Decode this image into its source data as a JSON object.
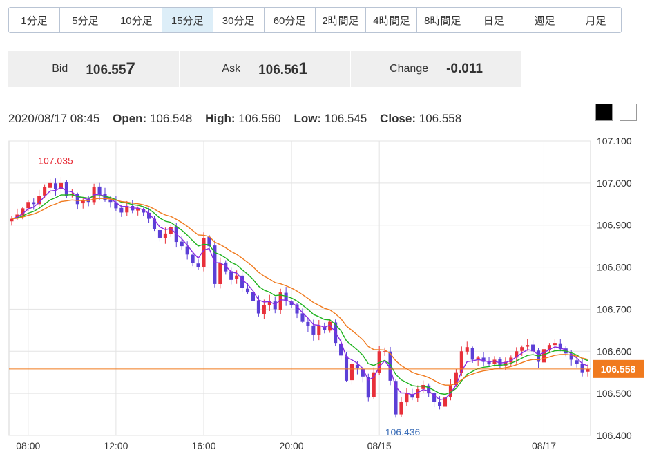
{
  "tabs": [
    "1分足",
    "5分足",
    "10分足",
    "15分足",
    "30分足",
    "60分足",
    "2時間足",
    "4時間足",
    "8時間足",
    "日足",
    "週足",
    "月足"
  ],
  "active_tab": 3,
  "quotes": {
    "bid": {
      "label": "Bid",
      "main": "106.55",
      "last": "7"
    },
    "ask": {
      "label": "Ask",
      "main": "106.56",
      "last": "1"
    },
    "change": {
      "label": "Change",
      "value": "-0.011"
    }
  },
  "ohlc": {
    "datetime": "2020/08/17 08:45",
    "open_label": "Open:",
    "open": "106.548",
    "high_label": "High:",
    "high": "106.560",
    "low_label": "Low:",
    "low": "106.545",
    "close_label": "Close:",
    "close": "106.558"
  },
  "theme_buttons": {
    "dark": "#000000",
    "light": "#ffffff"
  },
  "chart_data": {
    "type": "candlestick",
    "y_ticks": [
      "107.100",
      "107.000",
      "106.900",
      "106.800",
      "106.700",
      "106.600",
      "106.500",
      "106.400"
    ],
    "y_range": [
      106.4,
      107.1
    ],
    "x_ticks": [
      {
        "label": "08:00",
        "index": 3
      },
      {
        "label": "12:00",
        "index": 19
      },
      {
        "label": "16:00",
        "index": 35
      },
      {
        "label": "20:00",
        "index": 51
      },
      {
        "label": "08/15",
        "index": 67
      },
      {
        "label": "08/17",
        "index": 97
      }
    ],
    "max_marker": {
      "label": "107.035",
      "value": 107.035,
      "index": 9
    },
    "min_marker": {
      "label": "106.436",
      "value": 106.436,
      "index": 70
    },
    "current_price": {
      "label": "106.558",
      "value": 106.558,
      "color": "#f07a1e"
    },
    "colors": {
      "up": "#e8303a",
      "down": "#5b3fd6",
      "ma_short": "#8a2be2",
      "ma_mid": "#1fb31f",
      "ma_long": "#f07a1e",
      "grid": "#e3e3e3"
    },
    "closes": [
      106.915,
      106.925,
      106.94,
      106.955,
      106.95,
      106.97,
      106.99,
      107.0,
      106.985,
      107.0,
      106.97,
      106.975,
      106.95,
      106.96,
      106.955,
      106.99,
      106.975,
      106.96,
      106.955,
      106.94,
      106.93,
      106.945,
      106.935,
      106.94,
      106.93,
      106.915,
      106.89,
      106.87,
      106.88,
      106.895,
      106.86,
      106.85,
      106.83,
      106.81,
      106.8,
      106.87,
      106.85,
      106.76,
      106.81,
      106.79,
      106.77,
      106.78,
      106.75,
      106.74,
      106.72,
      106.69,
      106.71,
      106.72,
      106.7,
      106.74,
      106.72,
      106.71,
      106.69,
      106.67,
      106.66,
      106.64,
      106.66,
      106.65,
      106.67,
      106.62,
      106.59,
      106.53,
      106.57,
      106.56,
      106.54,
      106.49,
      106.55,
      106.6,
      106.6,
      106.53,
      106.45,
      106.48,
      106.5,
      106.49,
      106.51,
      106.52,
      106.5,
      106.48,
      106.47,
      106.49,
      106.52,
      106.55,
      106.6,
      106.61,
      106.58,
      106.585,
      106.575,
      106.57,
      106.58,
      106.565,
      106.575,
      106.585,
      106.6,
      106.61,
      106.615,
      106.6,
      106.575,
      106.605,
      106.615,
      106.62,
      106.605,
      106.595,
      106.58,
      106.57,
      106.55,
      106.558
    ]
  }
}
